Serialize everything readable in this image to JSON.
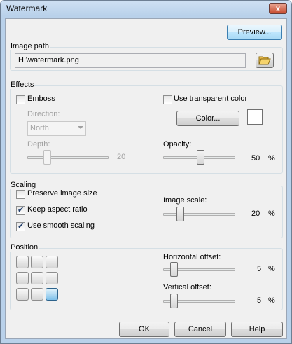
{
  "window": {
    "title": "Watermark",
    "close_glyph": "x"
  },
  "toolbar": {
    "preview_label": "Preview..."
  },
  "image_path": {
    "group_title": "Image path",
    "value": "H:\\watermark.png",
    "browse_icon": "folder-open-icon"
  },
  "effects": {
    "group_title": "Effects",
    "emboss_label": "Emboss",
    "emboss_checked": false,
    "direction_label": "Direction:",
    "direction_value": "North",
    "depth_label": "Depth:",
    "depth_value": "20",
    "transparent_label": "Use transparent color",
    "transparent_checked": false,
    "color_button_label": "Color...",
    "opacity_label": "Opacity:",
    "opacity_value": "50",
    "opacity_unit": "%"
  },
  "scaling": {
    "group_title": "Scaling",
    "preserve_label": "Preserve image size",
    "preserve_checked": false,
    "aspect_label": "Keep aspect ratio",
    "aspect_checked": true,
    "smooth_label": "Use smooth scaling",
    "smooth_checked": true,
    "image_scale_label": "Image scale:",
    "image_scale_value": "20",
    "image_scale_unit": "%"
  },
  "position": {
    "group_title": "Position",
    "selected": "bottom-right",
    "horizontal_label": "Horizontal offset:",
    "horizontal_value": "5",
    "horizontal_unit": "%",
    "vertical_label": "Vertical offset:",
    "vertical_value": "5",
    "vertical_unit": "%"
  },
  "footer": {
    "ok_label": "OK",
    "cancel_label": "Cancel",
    "help_label": "Help"
  }
}
